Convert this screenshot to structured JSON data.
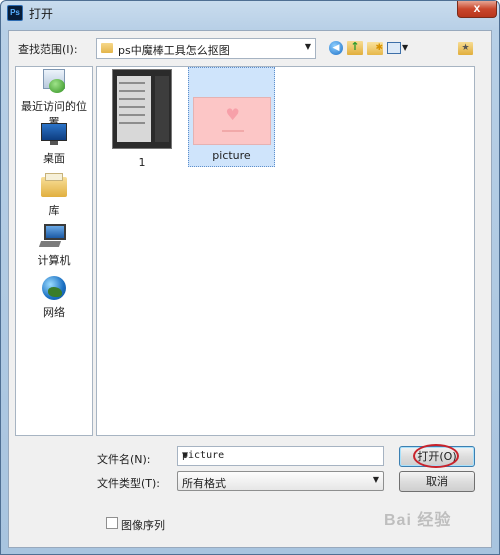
{
  "window": {
    "title": "打开",
    "app_icon_text": "Ps",
    "close_glyph": "x"
  },
  "toolbar": {
    "look_in_label": "查找范围(I):",
    "look_in_value": "ps中魔棒工具怎么抠图",
    "icons": [
      "back-icon",
      "up-folder-icon",
      "new-folder-icon",
      "view-menu-icon",
      "preferences-icon"
    ]
  },
  "places": [
    {
      "label": "最近访问的位置",
      "icon": "recent-places-icon"
    },
    {
      "label": "桌面",
      "icon": "desktop-icon"
    },
    {
      "label": "库",
      "icon": "libraries-icon"
    },
    {
      "label": "计算机",
      "icon": "computer-icon"
    },
    {
      "label": "网络",
      "icon": "network-icon"
    }
  ],
  "files": [
    {
      "name": "1",
      "selected": false
    },
    {
      "name": "picture",
      "selected": true
    }
  ],
  "filename": {
    "label": "文件名(N):",
    "value": "picture"
  },
  "filetype": {
    "label": "文件类型(T):",
    "value": "所有格式"
  },
  "buttons": {
    "open": "打开(O)",
    "cancel": "取消"
  },
  "image_sequence": {
    "label": "图像序列",
    "checked": false
  },
  "watermark": {
    "text": "Bai 经验"
  },
  "colors": {
    "selection": "#cfe4fb",
    "highlight_ring": "#c8232c",
    "frame": "#b7cfe6"
  }
}
